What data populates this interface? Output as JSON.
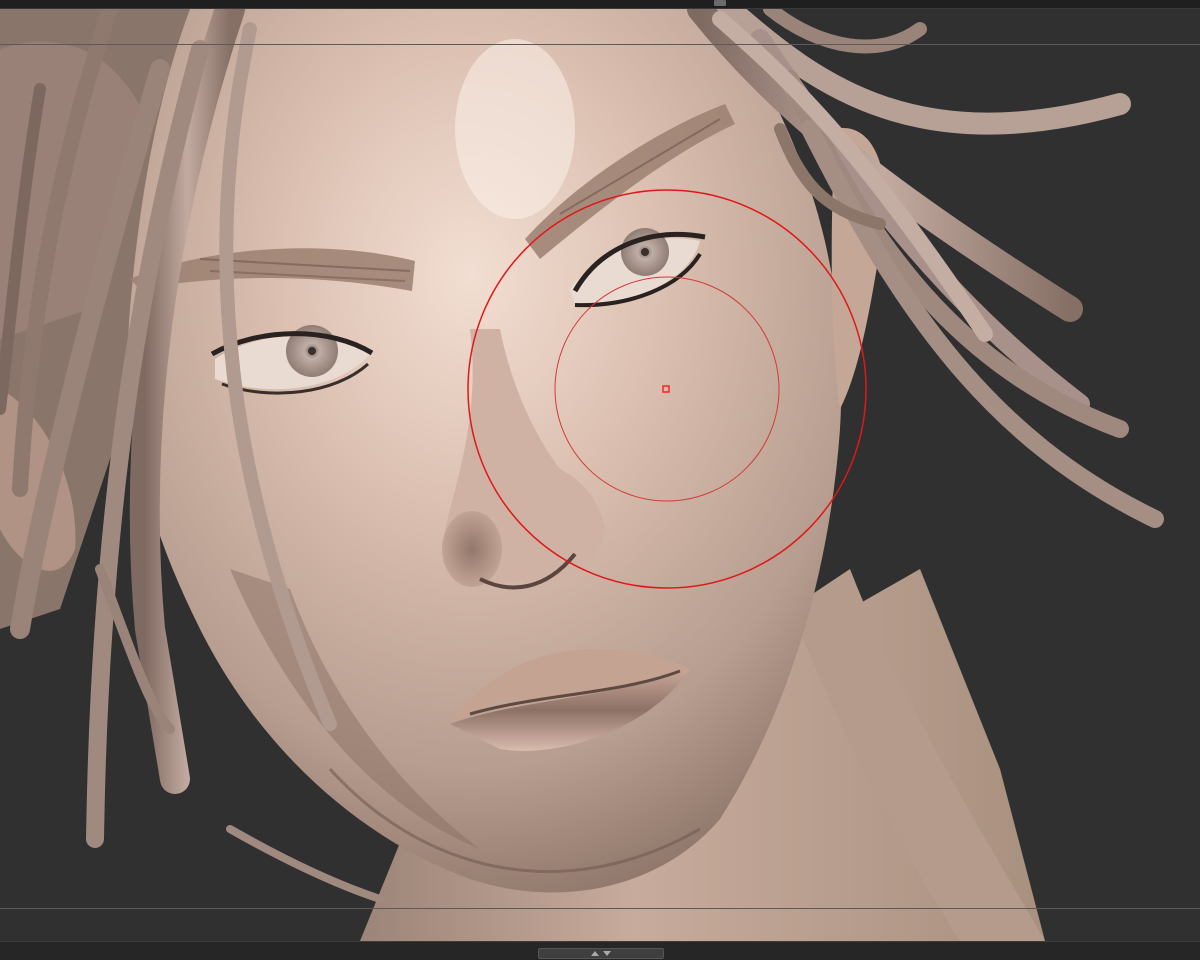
{
  "app": {
    "canvas_background": "#2e2e2e",
    "viewport_background": "#303030"
  },
  "viewport": {
    "model": "sculpted-female-head",
    "skin_color": "#c9ab9c",
    "hair_color": "#a58d82"
  },
  "brush_cursor": {
    "outer_ring_color": "#e01818",
    "inner_ring_color": "#d23a3a",
    "center_marker_color": "#ff2020"
  },
  "bottom_bar": {
    "handle_icons": [
      "chevron-up-icon",
      "chevron-down-icon"
    ]
  }
}
